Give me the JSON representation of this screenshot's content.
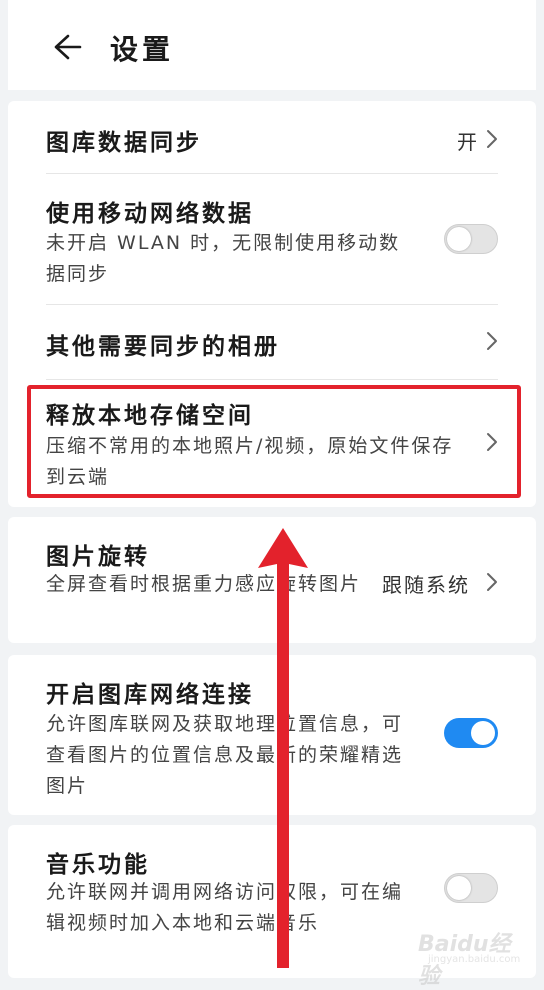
{
  "header": {
    "title": "设置"
  },
  "sync_card": {
    "gallery_sync": {
      "title": "图库数据同步",
      "value": "开"
    },
    "mobile_data": {
      "title": "使用移动网络数据",
      "desc": "未开启 WLAN 时，无限制使用移动数据同步",
      "enabled": false
    },
    "other_albums": {
      "title": "其他需要同步的相册"
    },
    "free_storage": {
      "title": "释放本地存储空间",
      "desc": "压缩不常用的本地照片/视频，原始文件保存到云端"
    }
  },
  "rotation_card": {
    "title": "图片旋转",
    "desc": "全屏查看时根据重力感应旋转图片",
    "value": "跟随系统"
  },
  "network_card": {
    "title": "开启图库网络连接",
    "desc": "允许图库联网及获取地理位置信息，可查看图片的位置信息及最新的荣耀精选图片",
    "enabled": true
  },
  "music_card": {
    "title": "音乐功能",
    "desc": "允许联网并调用网络访问权限，可在编辑视频时加入本地和云端音乐",
    "enabled": false
  },
  "watermark": {
    "text": "Baidu经验",
    "sub": "jingyan.baidu.com"
  },
  "colors": {
    "accent": "#1f8af2",
    "annotation_red": "#e3222c"
  }
}
